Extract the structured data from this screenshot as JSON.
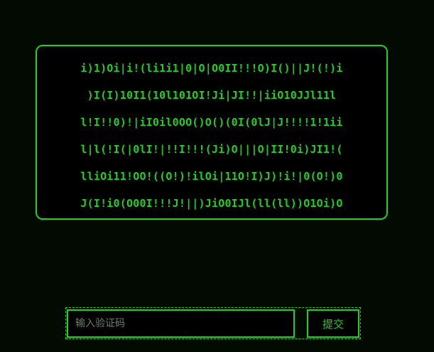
{
  "captcha": {
    "lines": [
      "i)1)Oi|i!(li1i1|0|O|O0II!!!O)I()||J!(!)i",
      ")I(I)10I1(10l101OI!Ji|JI!!|iiO10JJl11l",
      "l!I!!0)!|iI0il0OO()O()(0I(0lJ|J!!!!1!1ii",
      "l|l(!I(|0lI!|!!I!!!(Ji)O|||O|II!0i)JI1!(",
      "lliOi11!OO!((O!)!ilOi|11O!I)J)!i!|0(O!)0",
      "J(I!i0(O00I!!!J!||)JiO0IJl(ll(ll))O1Oi)O"
    ]
  },
  "form": {
    "input_placeholder": "输入验证码",
    "input_value": "",
    "submit_label": "提交"
  },
  "colors": {
    "background": "#020a02",
    "accent": "#1fd21f",
    "panel": "#000000"
  }
}
